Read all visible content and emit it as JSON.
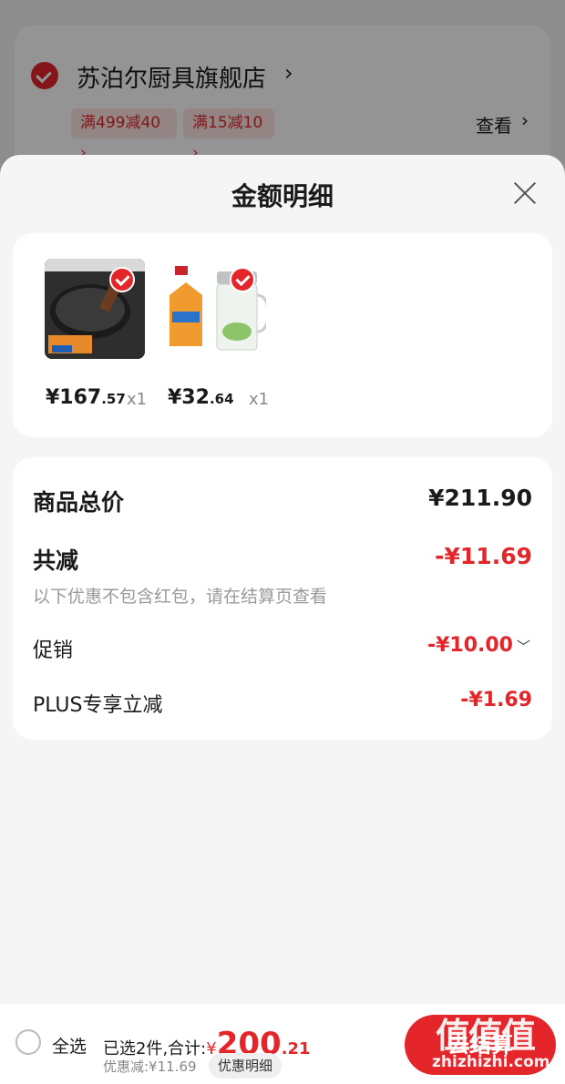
{
  "background_store": {
    "name": "苏泊尔厨具旗舰店",
    "arrow": "›",
    "coupons": [
      "满499减40 ›",
      "满15减10 ›"
    ],
    "view_label": "查看",
    "view_arrow": "›"
  },
  "sheet": {
    "title": "金额明细",
    "close_icon": "close-icon"
  },
  "products": [
    {
      "name": "pan",
      "price_int": "¥167",
      "price_dec": ".57",
      "qty": "x1",
      "checked": true
    },
    {
      "name": "cup",
      "price_int": "¥32",
      "price_dec": ".64",
      "qty": "x1",
      "checked": true
    }
  ],
  "summary": {
    "total_label": "商品总价",
    "total_value": "¥211.90",
    "reduce_label": "共减",
    "reduce_value": "-¥11.69",
    "note": "以下优惠不包含红包，请在结算页查看",
    "promo_label": "促销",
    "promo_value": "-¥10.00",
    "promo_chevron": "﹀",
    "plus_label": "PLUS专享立减",
    "plus_value": "-¥1.69"
  },
  "bottom_bar": {
    "select_all": "全选",
    "selected_text": "已选2件,合计:",
    "currency": "¥",
    "amount_int": "200",
    "amount_dec": ".21",
    "discount_text": "优惠减:¥11.69",
    "detail_chip": "优惠明细",
    "checkout_label": "去结算"
  },
  "watermark": {
    "logo": "值值值",
    "site": "zhizhizhi.com"
  },
  "colors": {
    "accent": "#e4262b",
    "muted": "#999999"
  }
}
